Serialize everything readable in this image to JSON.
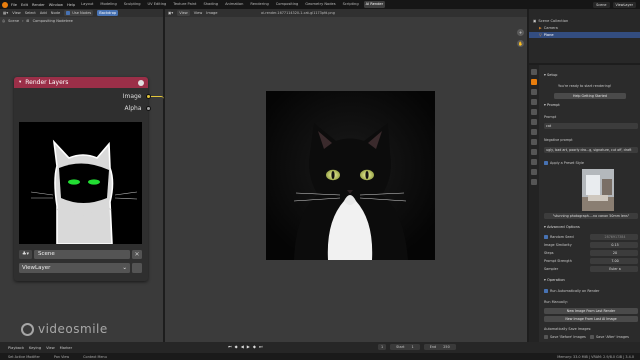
{
  "topbar": {
    "menus": [
      "File",
      "Edit",
      "Render",
      "Window",
      "Help"
    ],
    "workspaces": [
      "Layout",
      "Modeling",
      "Sculpting",
      "UV Editing",
      "Texture Paint",
      "Shading",
      "Animation",
      "Rendering",
      "Compositing",
      "Geometry Nodes",
      "Scripting",
      "AI Render"
    ],
    "active_workspace": "AI Render",
    "scene_label": "Scene",
    "view_layer_label": "ViewLayer"
  },
  "node_editor": {
    "header": [
      "View",
      "Select",
      "Add",
      "Node"
    ],
    "use_nodes_label": "Use Nodes",
    "backdrop_label": "Backdrop",
    "breadcrumb": [
      "Scene",
      "Compositing Nodetree"
    ],
    "node": {
      "title": "Render Layers",
      "outputs": [
        "Image",
        "Alpha"
      ],
      "scene_field": "Scene",
      "view_layer_field": "ViewLayer"
    }
  },
  "image_editor": {
    "header": [
      "View",
      "View",
      "Image"
    ],
    "filename": "ai-render-1677114320-1-cat-gl1173pfd.png"
  },
  "outliner": {
    "rows": [
      "Scene Collection",
      "Camera",
      "Plane"
    ]
  },
  "properties": {
    "section_setup": "Setup",
    "ready_text": "You're ready to start rendering!",
    "help_button": "Help Getting Started",
    "section_prompt": "Prompt",
    "prompt_label": "Prompt",
    "prompt_value": "cat",
    "negative_label": "Negative prompt",
    "negative_value": "ugly, bad art, poorly dra...g, signature, cut off, draft",
    "apply_preset_label": "Apply a Preset Style",
    "preset_text": "\"stunning photograph....no canon 50mm lens\"",
    "section_advanced": "Advanced Options",
    "random_seed_label": "Random Seed",
    "random_seed_value": "2876917384",
    "image_similarity_label": "Image Similarity",
    "image_similarity_value": "0.15",
    "steps_label": "Steps",
    "steps_value": "20",
    "prompt_strength_label": "Prompt Strength",
    "prompt_strength_value": "7.00",
    "sampler_label": "Sampler",
    "sampler_value": "Euler a",
    "section_operation": "Operation",
    "run_auto_label": "Run Automatically on Render",
    "run_manually_label": "Run Manually:",
    "new_from_last_render": "New Image From Last Render",
    "new_from_last_ai": "New Image From Last AI Image",
    "auto_save_label": "Automatically Save Images:",
    "save_before_label": "Save 'Before' Images",
    "save_after_label": "Save 'After' Images"
  },
  "timeline": {
    "items": [
      "Playback",
      "Keying",
      "View",
      "Marker"
    ],
    "start_label": "Start",
    "start_value": "1",
    "end_label": "End",
    "end_value": "250",
    "current_frame": "1"
  },
  "statusbar": {
    "items": [
      "Set Active Modifier",
      "Pan View",
      "Context Menu"
    ],
    "version": "Memory: 33.0 MiB | VRAM: 2.9/8.0 GiB | 3.4.0"
  },
  "watermark": {
    "text": "videosmile"
  },
  "colors": {
    "accent": "#e87d0d",
    "node_header": "#9b2f48",
    "toggle_blue": "#4772b3",
    "wire_yellow": "#e3c63a",
    "eye_green": "#2ecc40"
  }
}
